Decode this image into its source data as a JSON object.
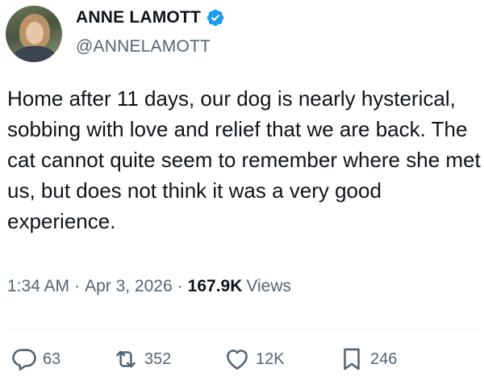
{
  "author": {
    "name": "ANNE LAMOTT",
    "handle": "@ANNELAMOTT",
    "verified_color": "#1d9bf0",
    "avatar_icon": "profile-photo"
  },
  "tweet": {
    "text": "Home after 11 days, our dog is nearly hysterical, sobbing with love and relief that we are back. The cat cannot quite seem to remember where she met us, but does not think it was a very good experience.",
    "time": "1:34 AM",
    "date": "Apr 3, 2026",
    "separator": "·",
    "views_count": "167.9K",
    "views_label": "Views"
  },
  "actions": {
    "replies": "63",
    "retweets": "352",
    "likes": "12K",
    "bookmarks": "246"
  },
  "colors": {
    "text": "#0f1419",
    "muted": "#536471",
    "divider": "#eff3f4",
    "accent": "#1d9bf0"
  }
}
